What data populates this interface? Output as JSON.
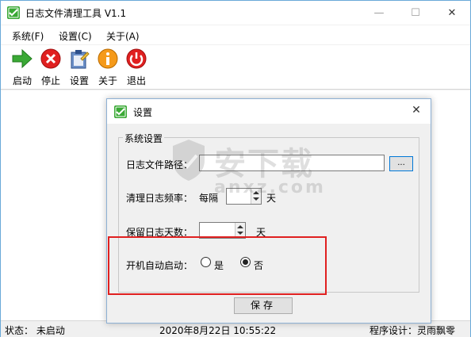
{
  "window": {
    "title": "日志文件清理工具 V1.1",
    "min_glyph": "—",
    "max_glyph": "☐",
    "close_glyph": "✕"
  },
  "menu": [
    "系统(F)",
    "设置(C)",
    "关于(A)"
  ],
  "toolbar": [
    {
      "label": "启动",
      "icon": "play-arrow-icon"
    },
    {
      "label": "停止",
      "icon": "stop-x-icon"
    },
    {
      "label": "设置",
      "icon": "settings-clipboard-icon"
    },
    {
      "label": "关于",
      "icon": "info-icon"
    },
    {
      "label": "退出",
      "icon": "power-icon"
    }
  ],
  "status": {
    "state": "状态：  未启动",
    "datetime": "2020年8月22日   10:55:22",
    "designer": "程序设计：灵雨飘零"
  },
  "dialog": {
    "title": "设置",
    "close_glyph": "✕",
    "group_title": "系统设置",
    "log_path_label": "日志文件路径：",
    "log_path_value": "",
    "browse_label": "...",
    "cleanup_freq_label": "清理日志频率：",
    "every_label": "每隔",
    "freq_value": "",
    "freq_unit": "天",
    "keep_days_label": "保留日志天数：",
    "keep_days_value": "",
    "keep_days_unit": "天",
    "autostart_label": "开机自动启动：",
    "yes_label": "是",
    "no_label": "否",
    "autostart_selected": "否",
    "save_label": "保存"
  },
  "watermark": {
    "text": "安下载",
    "sub": "anxz.com"
  },
  "colors": {
    "accent": "#0078d7",
    "highlight": "#e02020",
    "green": "#3aa935",
    "red": "#e02020",
    "orange": "#f59a1a"
  }
}
